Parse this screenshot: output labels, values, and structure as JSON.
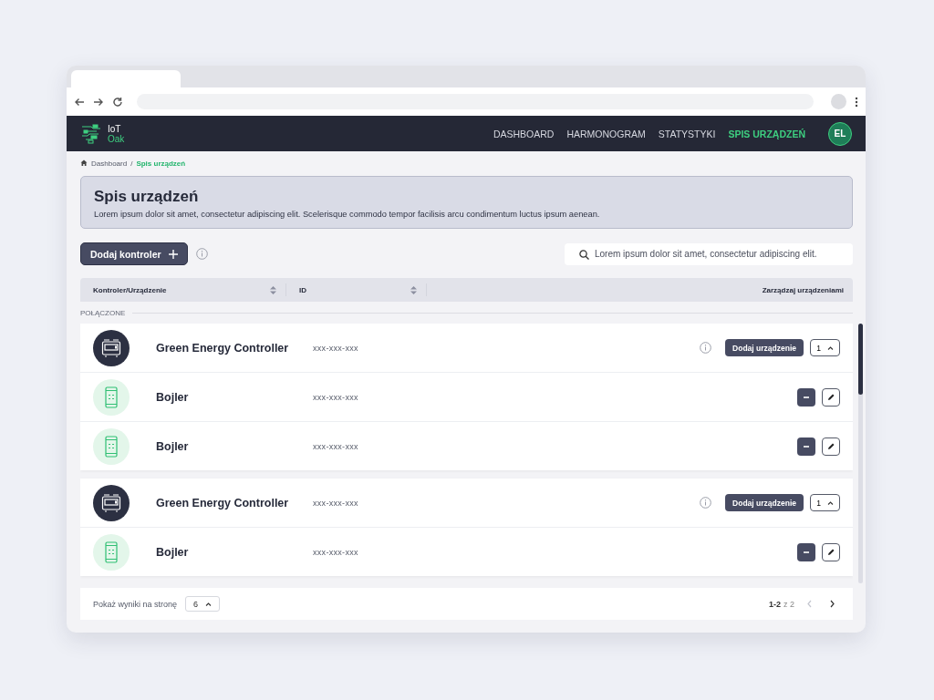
{
  "nav": {
    "logo_lines": [
      "IoT",
      "Oak"
    ],
    "items": [
      {
        "label": "DASHBOARD",
        "selected": false
      },
      {
        "label": "HARMONOGRAM",
        "selected": false
      },
      {
        "label": "STATYSTYKI",
        "selected": false
      },
      {
        "label": "SPIS URZĄDZEŃ",
        "selected": true
      }
    ],
    "avatar": "EL"
  },
  "breadcrumb_separator": "/",
  "breadcrumb": [
    {
      "label": "Dashboard",
      "selected": false
    },
    {
      "label": "Spis urządzeń",
      "selected": true
    }
  ],
  "header": {
    "title": "Spis urządzeń",
    "description": "Lorem ipsum dolor sit amet, consectetur adipiscing elit. Scelerisque commodo tempor facilisis arcu condimentum luctus ipsum aenean."
  },
  "toolbar": {
    "add_button": "Dodaj kontroler",
    "search": {
      "placeholder": "Lorem ipsum dolor sit amet, consectetur adipiscing elit."
    }
  },
  "table": {
    "columns": [
      {
        "label": "Kontroler/Urządzenie",
        "sortable": true
      },
      {
        "label": "ID",
        "sortable": true
      },
      {
        "label": "Zarządzaj urządzeniami",
        "sortable": false
      }
    ],
    "group_label": "POŁĄCZONE",
    "groups": [
      {
        "rows": [
          {
            "kind": "controller",
            "name": "Green Energy Controller",
            "id": "xxx-xxx-xxx",
            "action": "Dodaj urządzenie",
            "count": "1"
          },
          {
            "kind": "device",
            "name": "Bojler",
            "id": "xxx-xxx-xxx"
          },
          {
            "kind": "device",
            "name": "Bojler",
            "id": "xxx-xxx-xxx"
          }
        ]
      },
      {
        "rows": [
          {
            "kind": "controller",
            "name": "Green Energy Controller",
            "id": "xxx-xxx-xxx",
            "action": "Dodaj urządzenie",
            "count": "1"
          },
          {
            "kind": "device",
            "name": "Bojler",
            "id": "xxx-xxx-xxx"
          }
        ]
      }
    ]
  },
  "footer": {
    "page_size_label": "Pokaż wyniki na stronę",
    "page_size": "6",
    "range": "1-2",
    "total": "z 2",
    "previous": {
      "disabled": true
    },
    "next": {
      "disabled": false
    }
  }
}
